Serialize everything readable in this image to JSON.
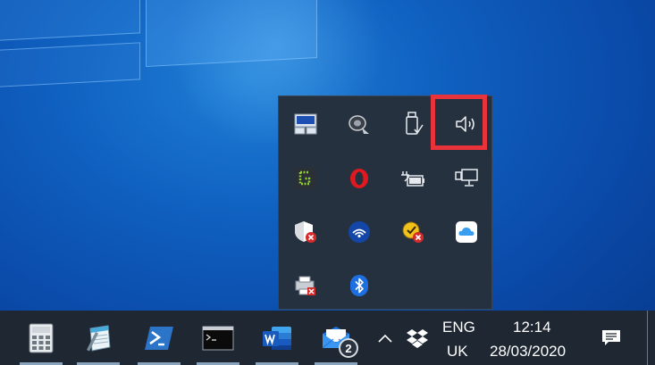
{
  "tray_overflow": {
    "icons": [
      {
        "name": "network-adapter-icon"
      },
      {
        "name": "speaker-dome-icon"
      },
      {
        "name": "usb-safely-remove-icon"
      },
      {
        "name": "volume-icon"
      },
      {
        "name": "gpu-tweak-icon"
      },
      {
        "name": "opera-icon"
      },
      {
        "name": "power-battery-icon"
      },
      {
        "name": "network-monitor-icon"
      },
      {
        "name": "defender-shield-icon"
      },
      {
        "name": "wireless-icon"
      },
      {
        "name": "security-alert-icon"
      },
      {
        "name": "icloud-icon"
      },
      {
        "name": "printer-error-icon"
      },
      {
        "name": "bluetooth-icon"
      }
    ]
  },
  "taskbar": {
    "apps": [
      {
        "name": "calculator-icon"
      },
      {
        "name": "notepad-icon"
      },
      {
        "name": "powershell-icon"
      },
      {
        "name": "command-prompt-icon"
      },
      {
        "name": "word-icon"
      },
      {
        "name": "mail-icon"
      }
    ],
    "mail_badge": "2",
    "language_line1": "ENG",
    "language_line2": "UK",
    "time": "12:14",
    "date": "28/03/2020"
  },
  "colors": {
    "taskbar_bg": "#1e2732",
    "flyout_bg": "#26313f",
    "highlight": "#e8333a",
    "wallpaper": "#0f5fbf"
  }
}
